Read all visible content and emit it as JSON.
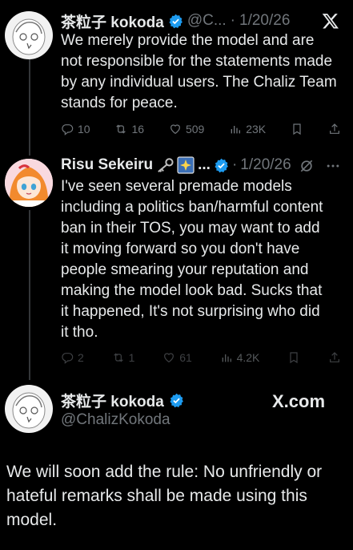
{
  "tweet1": {
    "name": "茶粒子 kokoda",
    "handle": "@C...",
    "separator": "·",
    "date": "1/20/26",
    "text": "We merely provide the model and are not responsible for the statements made by any individual users. The Chaliz Team stands for peace.",
    "stats": {
      "replies": "10",
      "reposts": "16",
      "likes": "509",
      "views": "23K"
    },
    "platform_logo": "X"
  },
  "tweet2": {
    "name": "Risu Sekeiru",
    "name_icons": [
      "key-emoji",
      "sparkle-picture-emoji"
    ],
    "ellipsis": "...",
    "separator": "·",
    "date": "1/20/26",
    "text": "I've seen several premade models including a politics ban/harmful content ban in their TOS, you may want to add it moving forward so you don't have people smearing your reputation and making the model look bad. Sucks that it happened, It's not surprising who did it tho.",
    "stats": {
      "replies": "2",
      "reposts": "1",
      "likes": "61",
      "views": "4.2K"
    }
  },
  "tweet3": {
    "name": "茶粒子 kokoda",
    "handle": "@ChalizKokoda",
    "brand": "X.com",
    "text": "We will soon add the rule: No unfriendly or hateful remarks shall be made using this model."
  },
  "colors": {
    "background": "#000000",
    "text": "#e7e9ea",
    "muted": "#71767b",
    "verified": "#1d9bf0",
    "thread_line": "#333639"
  }
}
